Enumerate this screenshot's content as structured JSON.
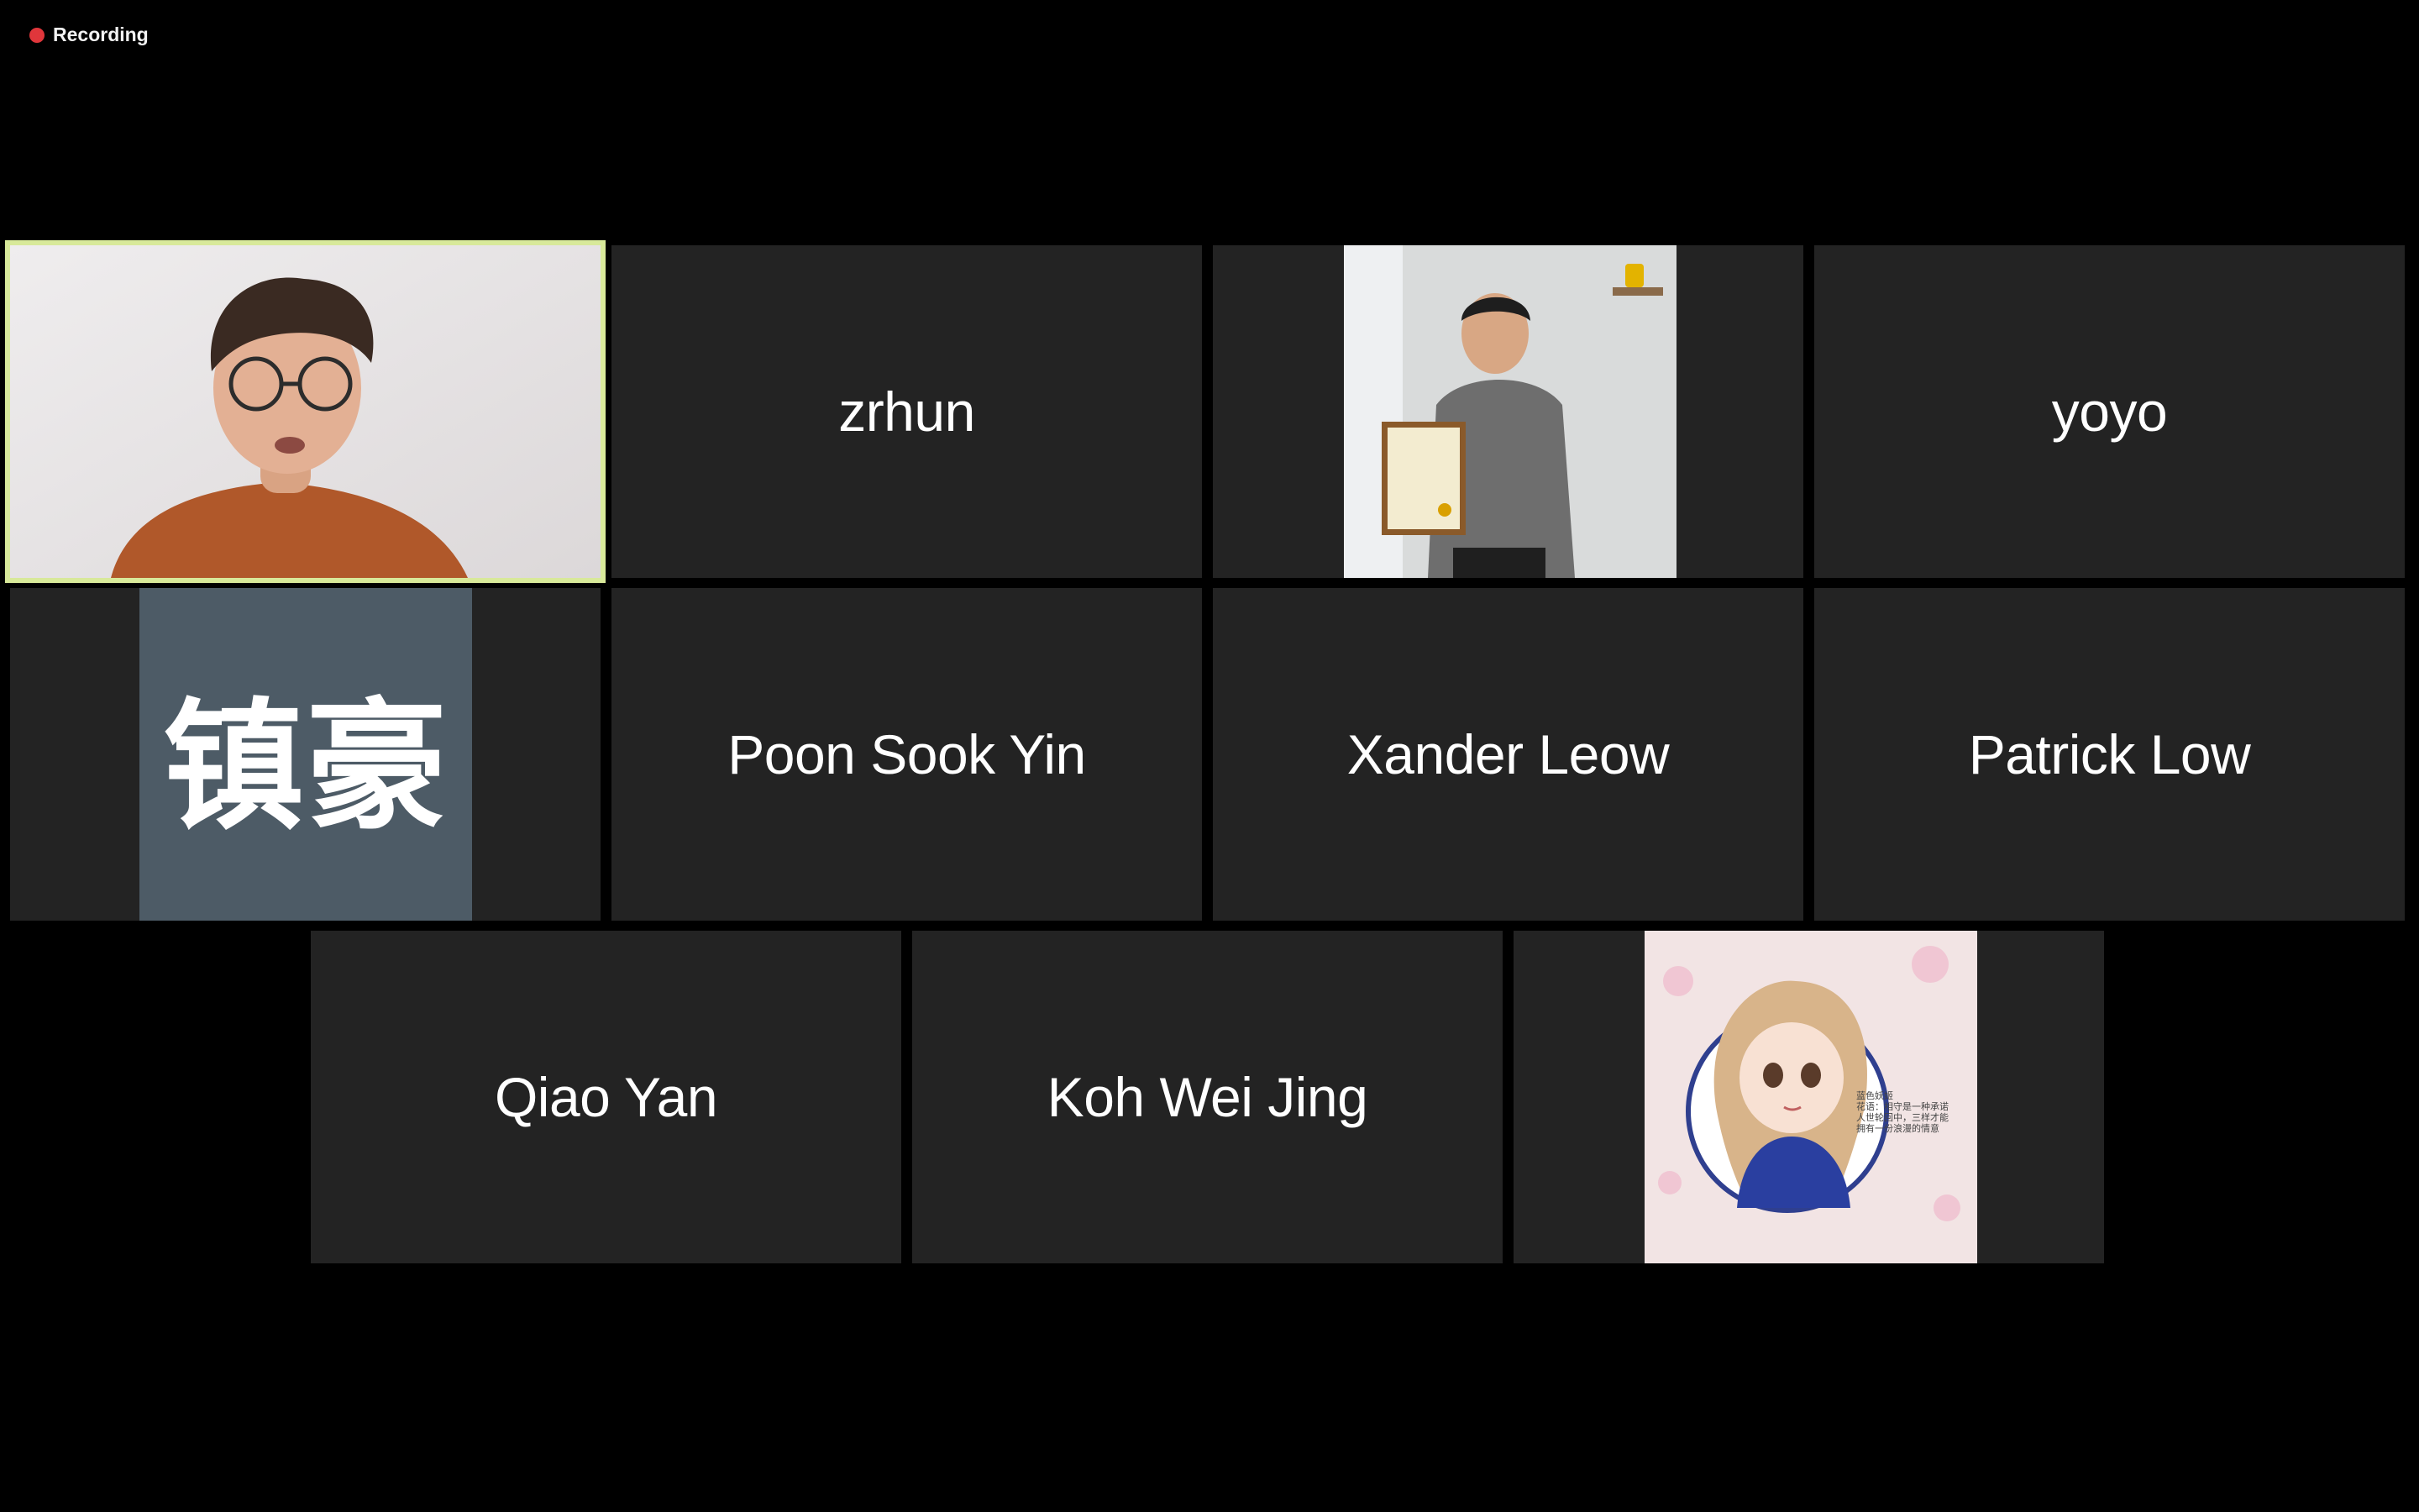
{
  "recording": {
    "label": "Recording",
    "dot_color": "#e0363b"
  },
  "participants": [
    {
      "name": "",
      "type": "video",
      "active": true
    },
    {
      "name": "zrhun",
      "type": "name"
    },
    {
      "name": "",
      "type": "video"
    },
    {
      "name": "yoyo",
      "type": "name"
    },
    {
      "name": "",
      "type": "avatar",
      "avatar_text": "镇豪"
    },
    {
      "name": "Poon Sook Yin",
      "type": "name"
    },
    {
      "name": "Xander Leow",
      "type": "name"
    },
    {
      "name": "Patrick Low",
      "type": "name"
    },
    {
      "name": "Qiao Yan",
      "type": "name"
    },
    {
      "name": "Koh Wei Jing",
      "type": "name"
    },
    {
      "name": "",
      "type": "picture",
      "picture_caption": [
        "蓝色妖姬",
        "花语：相守是一种承诺",
        "人世轮回中，三样才能",
        "拥有一份浪漫的情意"
      ]
    }
  ],
  "colors": {
    "background": "#000000",
    "tile": "#232323",
    "active_border": "#d8e99a",
    "avatar_bg": "#4d5b66"
  }
}
